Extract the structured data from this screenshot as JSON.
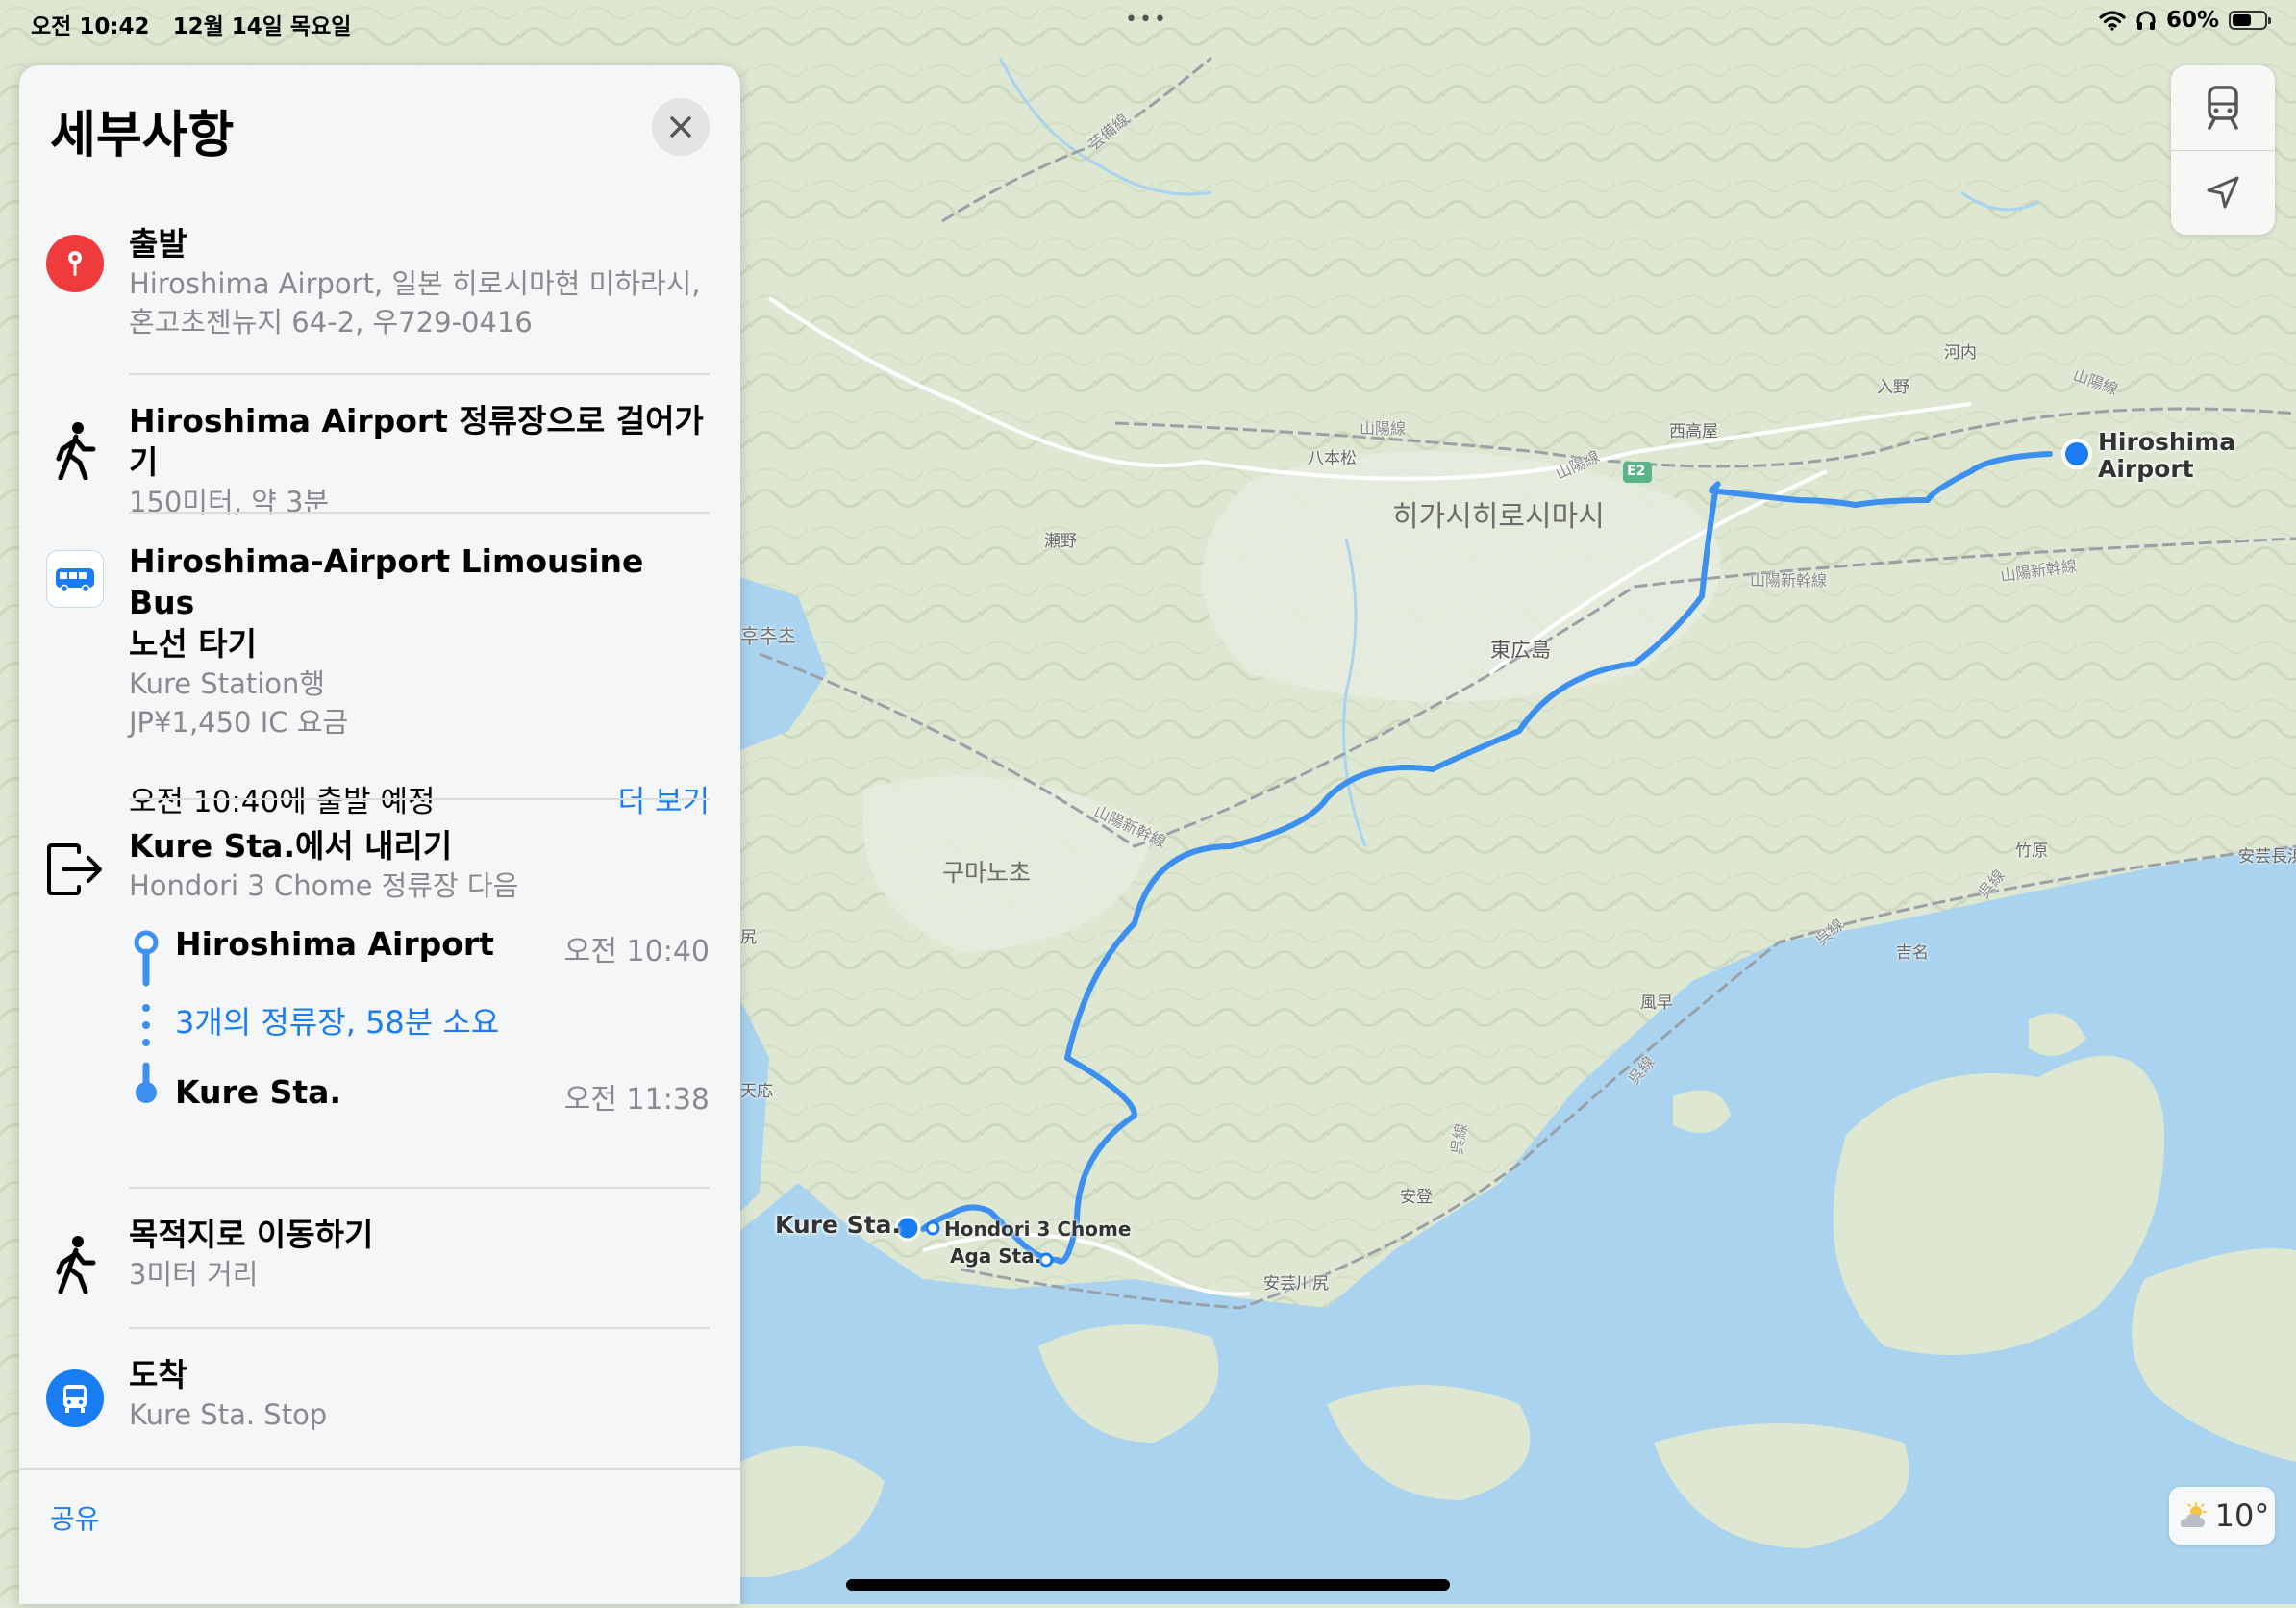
{
  "status_bar": {
    "time": "오전 10:42",
    "date": "12월 14일 목요일",
    "battery_text": "60%",
    "battery_level": 0.6
  },
  "panel": {
    "title": "세부사항",
    "steps": [
      {
        "id": "origin",
        "icon": "map-pin-icon",
        "title": "출발",
        "lines": [
          "Hiroshima Airport, 일본 히로시마현 미하라시,",
          "혼고초젠뉴지 64-2, 우729-0416"
        ]
      },
      {
        "id": "walk-to-stop",
        "icon": "walking-person-icon",
        "title": "Hiroshima Airport 정류장으로 걸어가기",
        "lines": [
          "150미터, 약 3분"
        ]
      },
      {
        "id": "board-bus",
        "icon": "bus-icon",
        "title_line1": "Hiroshima-Airport Limousine Bus",
        "title_line2": "노선 타기",
        "lines": [
          "Kure Station행",
          "JP¥1,450 IC 요금"
        ],
        "departure": "오전 10:40에 출발 예정",
        "more": "더 보기"
      },
      {
        "id": "alight",
        "icon": "exit-icon",
        "title": "Kure Sta.에서 내리기",
        "lines": [
          "Hondori 3 Chome 정류장 다음"
        ],
        "timeline": {
          "from_name": "Hiroshima Airport",
          "from_time": "오전 10:40",
          "summary": "3개의 정류장, 58분 소요",
          "to_name": "Kure Sta.",
          "to_time": "오전 11:38"
        }
      },
      {
        "id": "walk-to-dest",
        "icon": "walking-person-icon",
        "title": "목적지로 이동하기",
        "lines": [
          "3미터 거리"
        ]
      },
      {
        "id": "arrive",
        "icon": "bus-stop-icon",
        "title": "도착",
        "lines": [
          "Kure Sta. Stop"
        ]
      }
    ],
    "share": "공유"
  },
  "map": {
    "labels": {
      "city_main": "히가시히로시마시",
      "higashihiroshima": "東広島",
      "kumanocho": "구마노초",
      "fuchucho": "후추초",
      "hachihonmatsu": "八本松",
      "saijo": "西高屋",
      "iriya": "入野",
      "kochi": "河内",
      "seno": "瀬野",
      "takehara": "竹原",
      "kazahaya": "風早",
      "yoshina": "吉名",
      "aki": "安登",
      "akikawajiri": "安芸川尻",
      "akinagahama": "安芸長浜",
      "tennou": "天応",
      "kawajiri": "尻",
      "rail_sanyo1": "山陽線",
      "rail_sanyo2": "山陽線",
      "rail_sanyo3": "山陽線",
      "rail_shinkansen1": "山陽新幹線",
      "rail_shinkansen2": "山陽新幹線",
      "rail_shinkansen3": "山陽新幹線",
      "rail_geibi": "芸備線",
      "rail_kure1": "呉線",
      "rail_kure2": "呉線",
      "rail_kure3": "呉線",
      "rail_kure4": "呉線",
      "road_e2": "E2"
    },
    "stops": {
      "airport_line1": "Hiroshima",
      "airport_line2": "Airport",
      "kure": "Kure Sta.",
      "hondori": "Hondori 3 Chome",
      "aga": "Aga Sta."
    },
    "weather": "10°",
    "colors": {
      "route": "#3d8ff0",
      "water": "#a9d3ee",
      "land": "#dfe8d4",
      "accent": "#1a7cf2",
      "origin_pin": "#ef3b3b"
    }
  }
}
